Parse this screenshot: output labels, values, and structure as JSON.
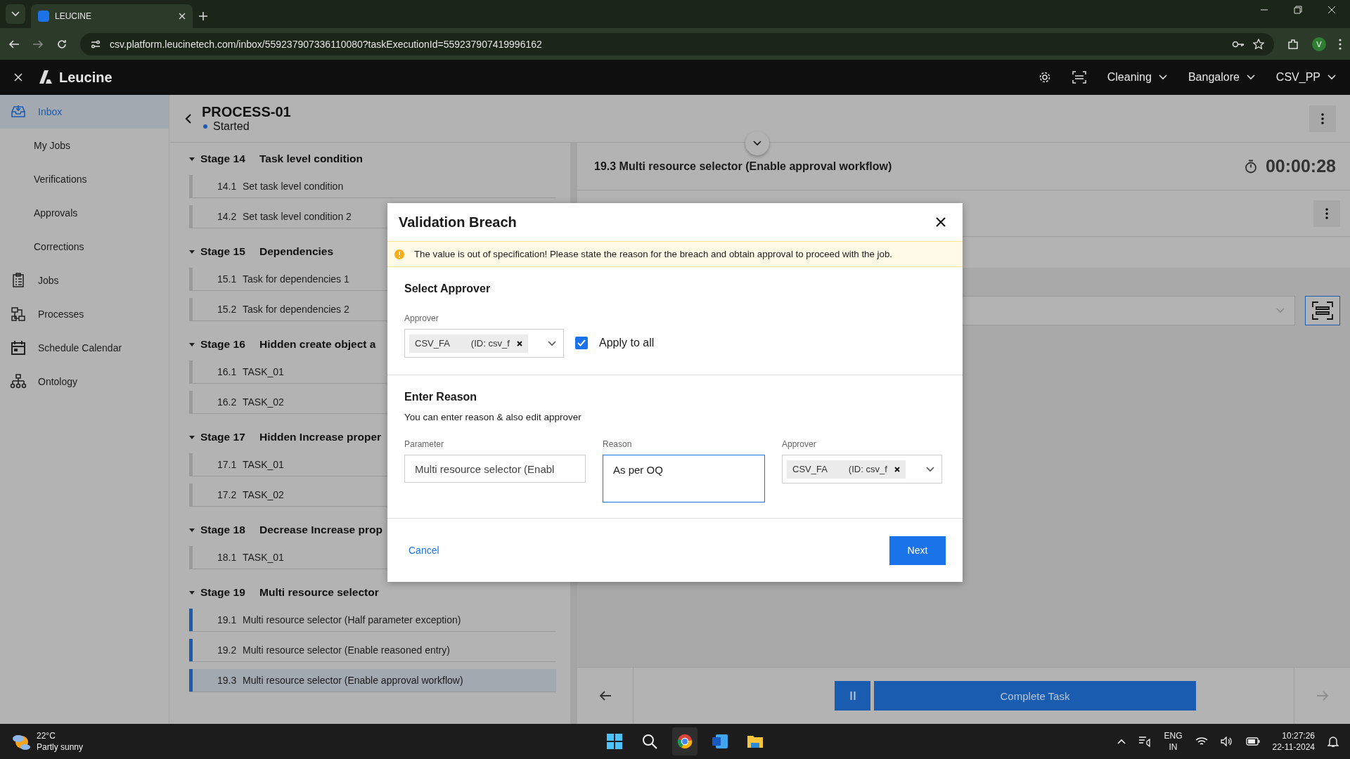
{
  "browser": {
    "tab_title": "LEUCINE",
    "url": "csv.platform.leucinetech.com/inbox/559237907336110080?taskExecutionId=559237907419996162",
    "profile": "V"
  },
  "app_header": {
    "brand": "Leucine",
    "menus": [
      {
        "label": "Cleaning"
      },
      {
        "label": "Bangalore"
      },
      {
        "label": "CSV_PP"
      }
    ]
  },
  "sidebar": {
    "items": [
      {
        "label": "Inbox",
        "kind": "section",
        "selected": true
      },
      {
        "label": "My Jobs",
        "kind": "sub",
        "selected": false
      },
      {
        "label": "Verifications",
        "kind": "sub",
        "selected": false
      },
      {
        "label": "Approvals",
        "kind": "sub",
        "selected": false
      },
      {
        "label": "Corrections",
        "kind": "sub",
        "selected": false
      },
      {
        "label": "Jobs",
        "kind": "section",
        "selected": false
      },
      {
        "label": "Processes",
        "kind": "section",
        "selected": false
      },
      {
        "label": "Schedule Calendar",
        "kind": "section",
        "selected": false
      },
      {
        "label": "Ontology",
        "kind": "section",
        "selected": false
      }
    ]
  },
  "process": {
    "title": "PROCESS-01",
    "status": "Started"
  },
  "stages": [
    {
      "number": "Stage 14",
      "title": "Task level condition",
      "tasks": [
        {
          "number": "14.1",
          "name": "Set task level condition",
          "color": "#9a9a9a",
          "selected": false
        },
        {
          "number": "14.2",
          "name": "Set task level condition 2",
          "color": "#9a9a9a",
          "selected": false
        }
      ]
    },
    {
      "number": "Stage 15",
      "title": "Dependencies",
      "tasks": [
        {
          "number": "15.1",
          "name": "Task for dependencies 1",
          "color": "#9a9a9a",
          "selected": false
        },
        {
          "number": "15.2",
          "name": "Task for dependencies 2",
          "color": "#9a9a9a",
          "selected": false
        }
      ]
    },
    {
      "number": "Stage 16",
      "title": "Hidden create object a",
      "tasks": [
        {
          "number": "16.1",
          "name": "TASK_01",
          "color": "#9a9a9a",
          "selected": false
        },
        {
          "number": "16.2",
          "name": "TASK_02",
          "color": "#9a9a9a",
          "selected": false
        }
      ]
    },
    {
      "number": "Stage 17",
      "title": "Hidden Increase proper",
      "tasks": [
        {
          "number": "17.1",
          "name": "TASK_01",
          "color": "#9a9a9a",
          "selected": false
        },
        {
          "number": "17.2",
          "name": "TASK_02",
          "color": "#9a9a9a",
          "selected": false
        }
      ]
    },
    {
      "number": "Stage 18",
      "title": "Decrease Increase prop",
      "tasks": [
        {
          "number": "18.1",
          "name": "TASK_01",
          "color": "#9a9a9a",
          "selected": false
        }
      ]
    },
    {
      "number": "Stage 19",
      "title": "Multi resource selector",
      "tasks": [
        {
          "number": "19.1",
          "name": "Multi resource selector (Half parameter exception)",
          "color": "#1a5cb0",
          "selected": false
        },
        {
          "number": "19.2",
          "name": "Multi resource selector (Enable reasoned entry)",
          "color": "#1a5cb0",
          "selected": false
        },
        {
          "number": "19.3",
          "name": "Multi resource selector (Enable approval workflow)",
          "color": "#1a5cb0",
          "selected": true
        }
      ]
    }
  ],
  "task_panel": {
    "title": "19.3 Multi resource selector (Enable approval workflow)",
    "timer": "00:00:28",
    "complete_button": "Complete Task"
  },
  "modal": {
    "title": "Validation Breach",
    "warning": "The value is out of specification! Please state the reason for the breach and obtain approval to proceed with the job.",
    "select_approver": {
      "heading": "Select Approver",
      "label": "Approver",
      "chip_name": "CSV_FA",
      "chip_id": "(ID: csv_f",
      "apply_to_all": {
        "label": "Apply to all",
        "checked": true
      }
    },
    "enter_reason": {
      "heading": "Enter Reason",
      "hint": "You can enter reason & also edit approver",
      "parameter": {
        "label": "Parameter",
        "value": "Multi resource selector (Enabl"
      },
      "reason": {
        "label": "Reason",
        "value": "As per OQ",
        "focused": true
      },
      "approver": {
        "label": "Approver",
        "chip_name": "CSV_FA",
        "chip_id": "(ID: csv_f"
      }
    },
    "cancel": "Cancel",
    "next": "Next"
  },
  "taskbar": {
    "temperature": "22°C",
    "weather": "Partly sunny",
    "language": "ENG",
    "region": "IN",
    "time": "10:27:26",
    "date": "22-11-2024"
  }
}
